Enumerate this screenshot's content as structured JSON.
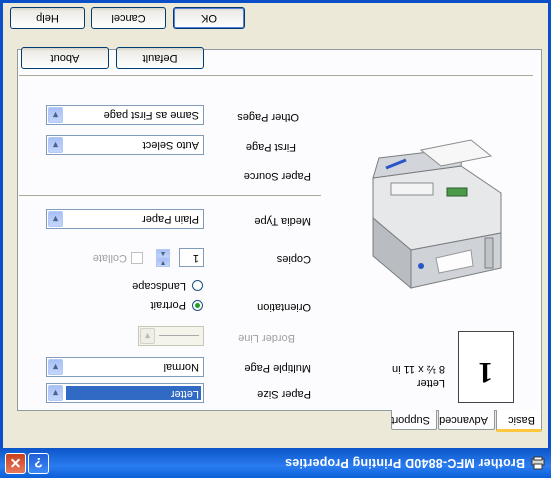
{
  "window": {
    "title": "Brother MFC-8840D Printing Properties",
    "caption_help": "?",
    "caption_close": "✕"
  },
  "tabs": [
    "Basic",
    "Advanced",
    "Support"
  ],
  "preview": {
    "paper_glyph": "1",
    "paper_name": "Letter",
    "paper_dims": "8 ½ x 11 in"
  },
  "form": {
    "paper_size": {
      "label": "Paper Size",
      "value": "Letter"
    },
    "multiple_page": {
      "label": "Multiple Page",
      "value": "Normal"
    },
    "border_line": {
      "label": "Border Line"
    },
    "orientation": {
      "label": "Orientation",
      "options": [
        "Portrait",
        "Landscape"
      ],
      "selected": "Portrait"
    },
    "copies": {
      "label": "Copies",
      "value": "1",
      "collate_label": "Collate"
    },
    "media_type": {
      "label": "Media Type",
      "value": "Plain Paper"
    },
    "paper_source": {
      "label": "Paper Source"
    },
    "first_page": {
      "label": "First Page",
      "value": "Auto Select"
    },
    "other_pages": {
      "label": "Other Pages",
      "value": "Same as First page"
    }
  },
  "buttons": {
    "default": "Default",
    "about": "About",
    "ok": "OK",
    "cancel": "Cancel",
    "help": "Help"
  },
  "colors": {
    "titlebar": "#0a5fd8",
    "frame": "#ece9d8",
    "selection": "#316ac5"
  }
}
